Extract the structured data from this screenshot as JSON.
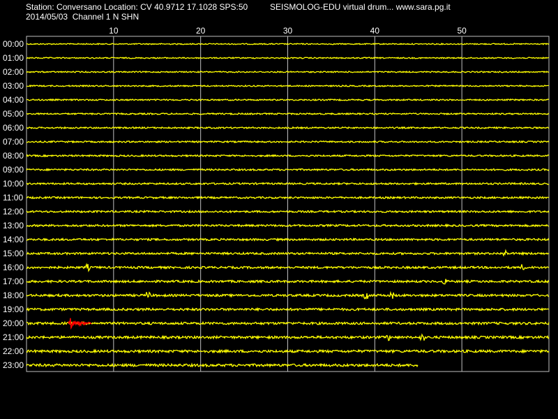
{
  "header": {
    "station_line": "Station: Conversano Location: CV 40.9712 17.1028 SPS:50",
    "program_line": "SEISMOLOG-EDU virtual drum... www.sara.pg.it",
    "date_line": "2014/05/03  Channel 1 N SHN"
  },
  "colors": {
    "background": "#000000",
    "trace": "#ffff00",
    "event": "#ff0000",
    "grid": "#c0c0c0",
    "text": "#ffffff"
  },
  "chart_data": {
    "type": "line",
    "title": "",
    "xlabel": "",
    "ylabel": "",
    "x_range_minutes": [
      0,
      60
    ],
    "x_ticks": [
      10,
      20,
      30,
      40,
      50
    ],
    "x_tick_labels": [
      "10",
      "20",
      "30",
      "40",
      "50"
    ],
    "rows": [
      "00:00",
      "01:00",
      "02:00",
      "03:00",
      "04:00",
      "05:00",
      "06:00",
      "07:00",
      "08:00",
      "09:00",
      "10:00",
      "11:00",
      "12:00",
      "13:00",
      "14:00",
      "15:00",
      "16:00",
      "17:00",
      "18:00",
      "19:00",
      "20:00",
      "21:00",
      "22:00",
      "23:00"
    ],
    "last_row_end_minute": 45,
    "event": {
      "row": "20:00",
      "start_minute": 4.8,
      "end_minute": 7.5,
      "color": "red"
    },
    "spikes": [
      {
        "row": "15:00",
        "minute": 55
      },
      {
        "row": "16:00",
        "minute": 7
      },
      {
        "row": "16:00",
        "minute": 57
      },
      {
        "row": "17:00",
        "minute": 48
      },
      {
        "row": "18:00",
        "minute": 14
      },
      {
        "row": "18:00",
        "minute": 39
      },
      {
        "row": "18:00",
        "minute": 42
      },
      {
        "row": "21:00",
        "minute": 41.5
      },
      {
        "row": "21:00",
        "minute": 45.5
      }
    ],
    "grid": true
  }
}
